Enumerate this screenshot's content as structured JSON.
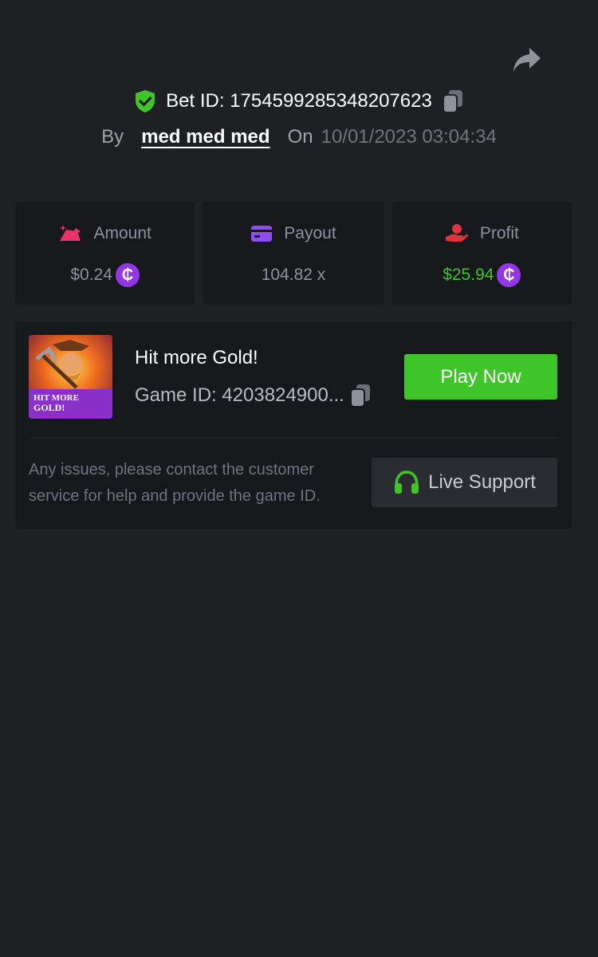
{
  "header": {
    "share_icon": "share-icon",
    "bet_label": "Bet ID: 1754599285348207623",
    "by_label": "By",
    "username": "med med med",
    "on_label": "On",
    "datetime": "10/01/2023 03:04:34"
  },
  "stats": [
    {
      "icon": "amount-icon",
      "label": "Amount",
      "value": "$0.24",
      "coin": "₵",
      "color": "#e8336a"
    },
    {
      "icon": "card-icon",
      "label": "Payout",
      "value": "104.82 x",
      "color": "#8f4cf0"
    },
    {
      "icon": "hand-coin-icon",
      "label": "Profit",
      "value": "$25.94",
      "coin": "₵",
      "color": "#e0323a",
      "value_color": "#3fc42a"
    }
  ],
  "game": {
    "title": "Hit more Gold!",
    "thumb_text_line1": "HIT MORE",
    "thumb_text_line2": "GOLD!",
    "game_id": "Game ID: 4203824900...",
    "play_label": "Play Now",
    "help_text": "Any issues, please contact the customer service for help and provide the game ID.",
    "support_label": "Live Support"
  },
  "colors": {
    "background": "#1f2024",
    "card": "#17181b",
    "accent_green": "#3fc42a",
    "coin_purple": "#9336e8"
  }
}
